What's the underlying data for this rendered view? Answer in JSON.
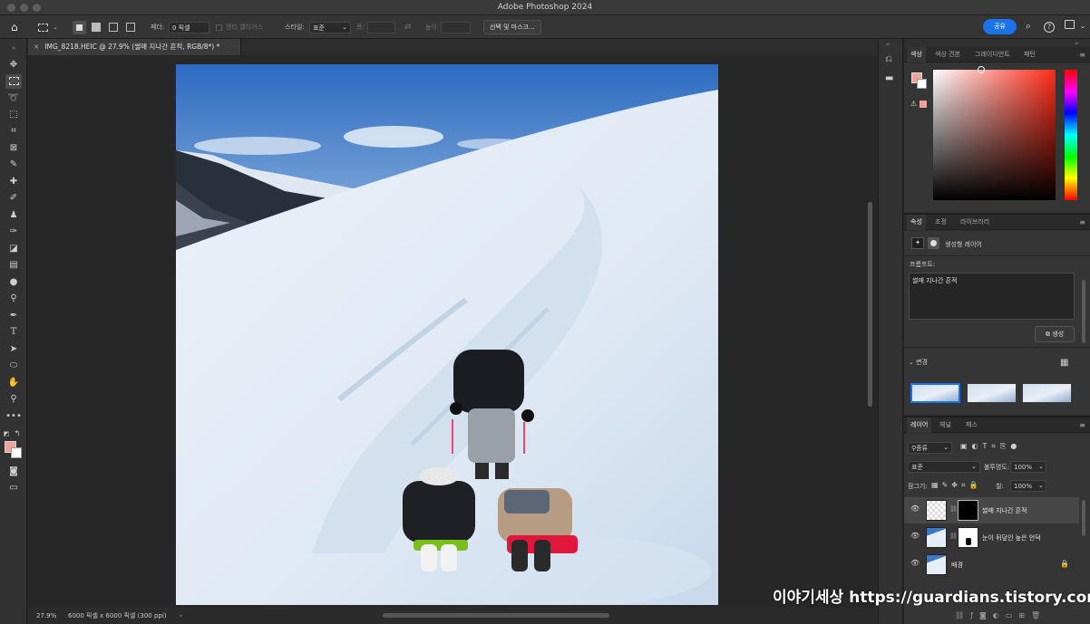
{
  "window": {
    "title": "Adobe Photoshop 2024"
  },
  "options_bar": {
    "feather_label": "페더:",
    "feather_value": "0 픽셀",
    "anti_alias_label": "앤티 앨리어스",
    "style_label": "스타일:",
    "style_value": "표준",
    "width_label": "폭:",
    "height_label": "높이:",
    "select_mask_button": "선택 및 마스크...",
    "share_button": "공유"
  },
  "document": {
    "tab_title": "IMG_8218.HEIC @ 27.9% (썰매 지나간 흔적, RGB/8*) *",
    "zoom": "27.9%",
    "doc_info": "6000 픽셀 x 6000 픽셀 (300 ppi)"
  },
  "color_panel": {
    "tabs": [
      "색상",
      "색상 견본",
      "그레이디언트",
      "패턴"
    ],
    "foreground_color": "#f1a39a",
    "background_color": "#ffffff"
  },
  "properties_panel": {
    "tabs": [
      "속성",
      "조정",
      "라이브러리"
    ],
    "layer_type": "생성형 레이어",
    "prompt_label": "프롬프트:",
    "prompt_text": "썰매 지나간 흔적",
    "generate_button": "생성",
    "variations_label": "변경"
  },
  "layers_panel": {
    "tabs": [
      "레이어",
      "채널",
      "패스"
    ],
    "filter_kind": "종류",
    "blend_mode": "표준",
    "opacity_label": "불투명도:",
    "opacity_value": "100%",
    "lock_label": "잠그기:",
    "fill_label": "칠:",
    "fill_value": "100%",
    "layers": [
      {
        "name": "썰매 지나간 흔적",
        "selected": true
      },
      {
        "name": "눈이 뒤덮인 높은 언덕",
        "selected": false
      },
      {
        "name": "배경",
        "selected": false
      }
    ]
  },
  "watermark": "이야기세상 https://guardians.tistory.com"
}
